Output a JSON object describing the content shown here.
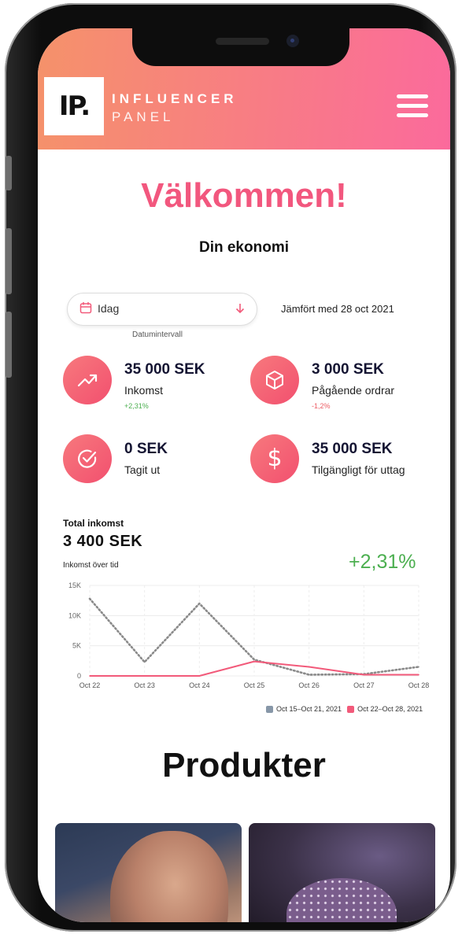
{
  "header": {
    "logo_text": "IP.",
    "brand_line1": "INFLUENCER",
    "brand_line2": "PANEL",
    "menu_icon": "hamburger-icon",
    "gradient": [
      "#f5926a",
      "#fb6a9c"
    ]
  },
  "welcome": "Välkommen!",
  "subtitle": "Din ekonomi",
  "date_filter": {
    "value": "Idag",
    "caption": "Datumintervall",
    "compare_text": "Jämfört med 28 oct 2021"
  },
  "stats": [
    {
      "icon": "trend-up-icon",
      "value": "35 000 SEK",
      "label": "Inkomst",
      "change": "+2,31%",
      "change_type": "positive"
    },
    {
      "icon": "box-icon",
      "value": "3 000 SEK",
      "label": "Pågående ordrar",
      "change": "-1,2%",
      "change_type": "negative"
    },
    {
      "icon": "check-circle-icon",
      "value": "0 SEK",
      "label": "Tagit ut",
      "change": "",
      "change_type": ""
    },
    {
      "icon": "dollar-icon",
      "value": "35 000 SEK",
      "label": "Tilgängligt för uttag",
      "change": "",
      "change_type": ""
    }
  ],
  "total": {
    "label": "Total inkomst",
    "value": "3 400  SEK",
    "over_time_label": "Inkomst över tid",
    "change_pct": "+2,31%"
  },
  "chart_data": {
    "type": "line",
    "categories": [
      "Oct 22",
      "Oct 23",
      "Oct 24",
      "Oct 25",
      "Oct 26",
      "Oct 27",
      "Oct 28"
    ],
    "y_ticks": [
      "15K",
      "10K",
      "5K",
      "0"
    ],
    "ylim": [
      0,
      15000
    ],
    "grid": true,
    "legend_position": "bottom-right",
    "series": [
      {
        "name": "Oct 15–Oct 21, 2021",
        "style": "dotted",
        "color": "#8a8a8a",
        "values": [
          12800,
          2300,
          12000,
          2700,
          200,
          300,
          1500
        ]
      },
      {
        "name": "Oct 22–Oct 28, 2021",
        "style": "solid",
        "color": "#f25a7a",
        "values": [
          0,
          0,
          0,
          2400,
          1500,
          200,
          200
        ]
      }
    ],
    "legend_swatch_colors": [
      "#8797a8",
      "#f25a7a"
    ]
  },
  "products_title": "Produkter"
}
